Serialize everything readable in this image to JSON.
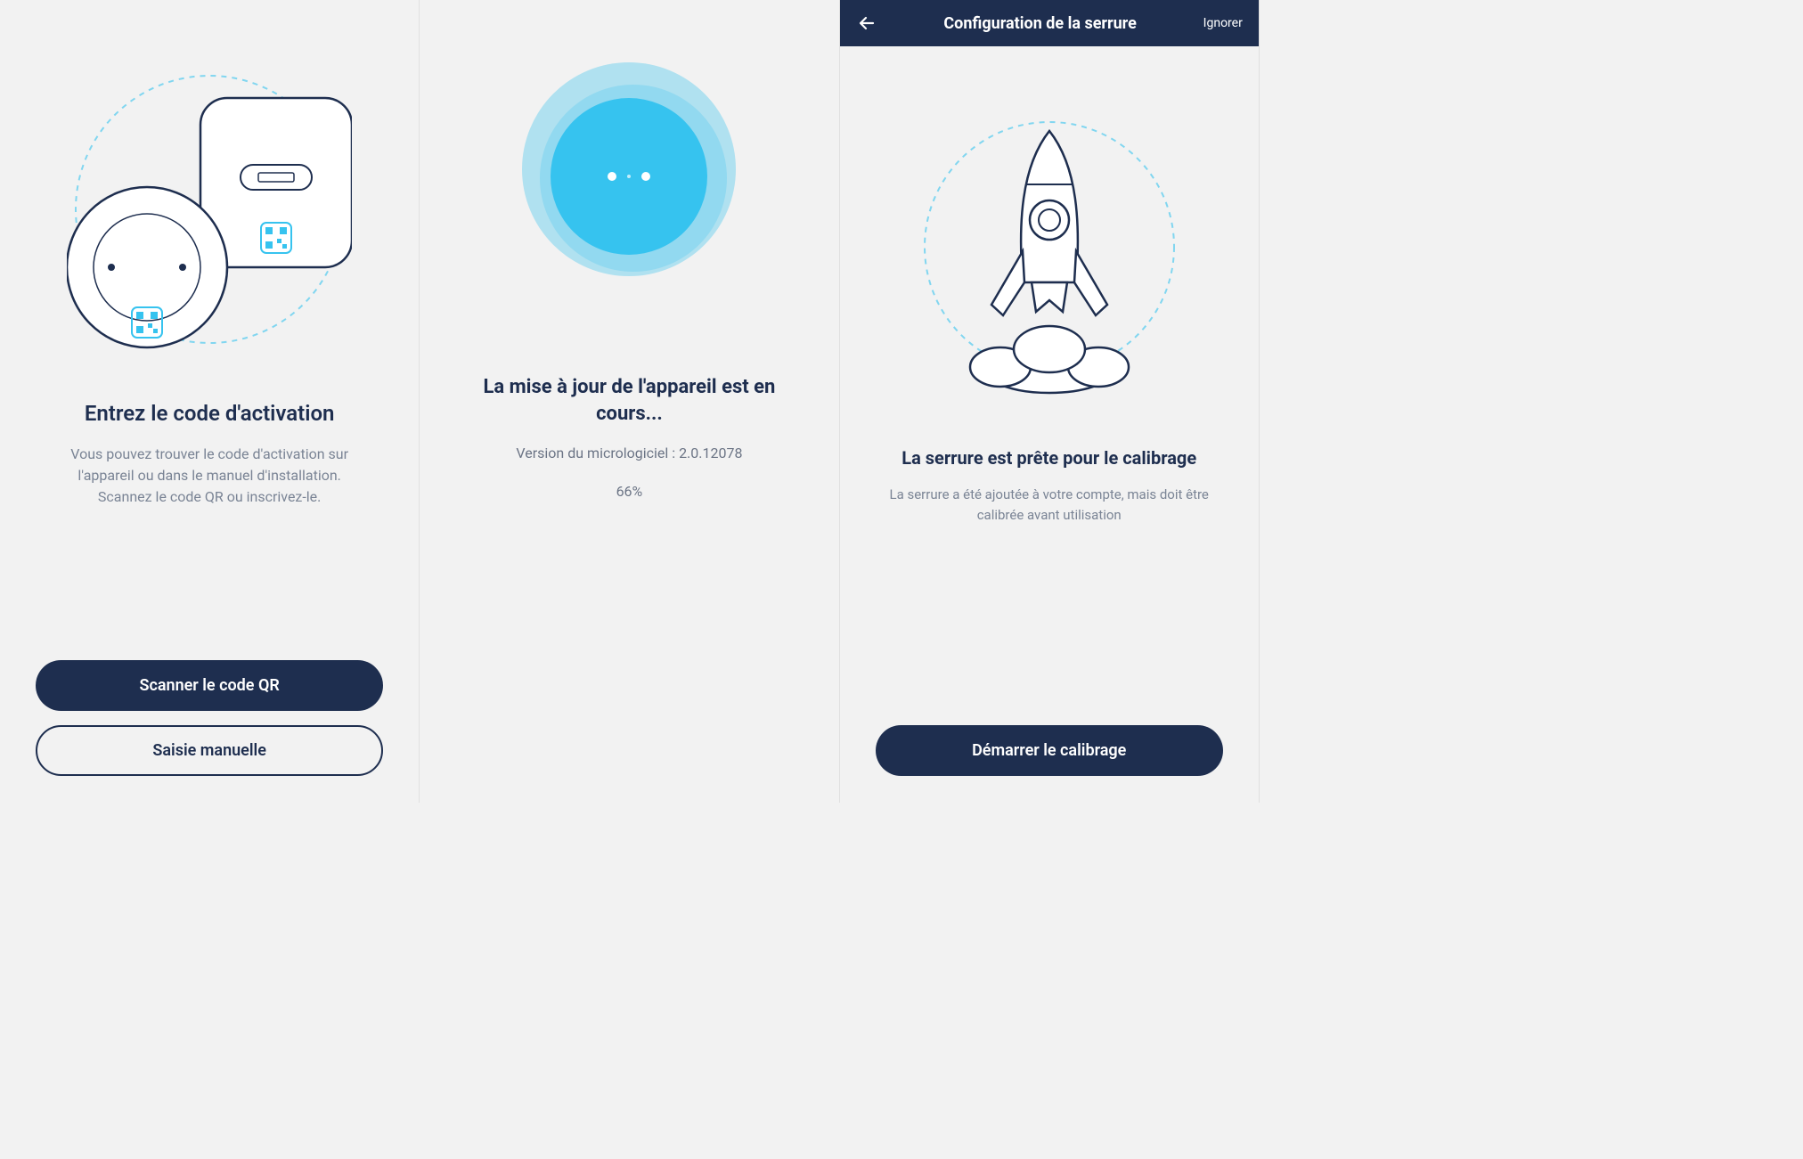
{
  "screen1": {
    "title": "Entrez le code d'activation",
    "description": "Vous pouvez trouver le code d'activation sur l'appareil ou dans le manuel d'installation. Scannez le code QR ou inscrivez-le.",
    "scan_button": "Scanner le code QR",
    "manual_button": "Saisie manuelle"
  },
  "screen2": {
    "title": "La mise à jour de l'appareil est en cours...",
    "firmware_label": "Version du micrologiciel : ",
    "firmware_version": "2.0.12078",
    "progress": "66%"
  },
  "screen3": {
    "header_title": "Configuration de la serrure",
    "header_skip": "Ignorer",
    "title": "La serrure est prête pour le calibrage",
    "description": "La serrure a été ajoutée à votre compte, mais doit être calibrée avant utilisation",
    "start_button": "Démarrer le calibrage"
  },
  "colors": {
    "primary_dark": "#1e2e4f",
    "accent_blue": "#36c3ef",
    "text_muted": "#7a8495"
  }
}
